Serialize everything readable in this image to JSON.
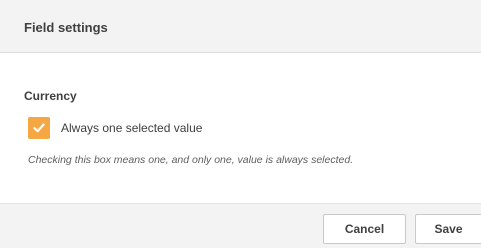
{
  "header": {
    "title": "Field settings"
  },
  "section": {
    "label": "Currency"
  },
  "checkbox": {
    "label": "Always one selected value",
    "checked": true,
    "color": "#f4a742"
  },
  "help": {
    "text": "Checking this box means one, and only one, value is always selected."
  },
  "footer": {
    "cancel_label": "Cancel",
    "save_label": "Save"
  }
}
